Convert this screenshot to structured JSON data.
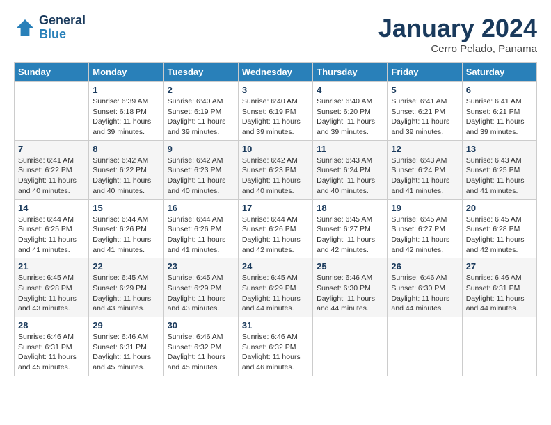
{
  "header": {
    "logo_line1": "General",
    "logo_line2": "Blue",
    "month": "January 2024",
    "location": "Cerro Pelado, Panama"
  },
  "days_of_week": [
    "Sunday",
    "Monday",
    "Tuesday",
    "Wednesday",
    "Thursday",
    "Friday",
    "Saturday"
  ],
  "weeks": [
    [
      {
        "day": "",
        "text": ""
      },
      {
        "day": "1",
        "text": "Sunrise: 6:39 AM\nSunset: 6:18 PM\nDaylight: 11 hours\nand 39 minutes."
      },
      {
        "day": "2",
        "text": "Sunrise: 6:40 AM\nSunset: 6:19 PM\nDaylight: 11 hours\nand 39 minutes."
      },
      {
        "day": "3",
        "text": "Sunrise: 6:40 AM\nSunset: 6:19 PM\nDaylight: 11 hours\nand 39 minutes."
      },
      {
        "day": "4",
        "text": "Sunrise: 6:40 AM\nSunset: 6:20 PM\nDaylight: 11 hours\nand 39 minutes."
      },
      {
        "day": "5",
        "text": "Sunrise: 6:41 AM\nSunset: 6:21 PM\nDaylight: 11 hours\nand 39 minutes."
      },
      {
        "day": "6",
        "text": "Sunrise: 6:41 AM\nSunset: 6:21 PM\nDaylight: 11 hours\nand 39 minutes."
      }
    ],
    [
      {
        "day": "7",
        "text": "Sunrise: 6:41 AM\nSunset: 6:22 PM\nDaylight: 11 hours\nand 40 minutes."
      },
      {
        "day": "8",
        "text": "Sunrise: 6:42 AM\nSunset: 6:22 PM\nDaylight: 11 hours\nand 40 minutes."
      },
      {
        "day": "9",
        "text": "Sunrise: 6:42 AM\nSunset: 6:23 PM\nDaylight: 11 hours\nand 40 minutes."
      },
      {
        "day": "10",
        "text": "Sunrise: 6:42 AM\nSunset: 6:23 PM\nDaylight: 11 hours\nand 40 minutes."
      },
      {
        "day": "11",
        "text": "Sunrise: 6:43 AM\nSunset: 6:24 PM\nDaylight: 11 hours\nand 40 minutes."
      },
      {
        "day": "12",
        "text": "Sunrise: 6:43 AM\nSunset: 6:24 PM\nDaylight: 11 hours\nand 41 minutes."
      },
      {
        "day": "13",
        "text": "Sunrise: 6:43 AM\nSunset: 6:25 PM\nDaylight: 11 hours\nand 41 minutes."
      }
    ],
    [
      {
        "day": "14",
        "text": "Sunrise: 6:44 AM\nSunset: 6:25 PM\nDaylight: 11 hours\nand 41 minutes."
      },
      {
        "day": "15",
        "text": "Sunrise: 6:44 AM\nSunset: 6:26 PM\nDaylight: 11 hours\nand 41 minutes."
      },
      {
        "day": "16",
        "text": "Sunrise: 6:44 AM\nSunset: 6:26 PM\nDaylight: 11 hours\nand 41 minutes."
      },
      {
        "day": "17",
        "text": "Sunrise: 6:44 AM\nSunset: 6:26 PM\nDaylight: 11 hours\nand 42 minutes."
      },
      {
        "day": "18",
        "text": "Sunrise: 6:45 AM\nSunset: 6:27 PM\nDaylight: 11 hours\nand 42 minutes."
      },
      {
        "day": "19",
        "text": "Sunrise: 6:45 AM\nSunset: 6:27 PM\nDaylight: 11 hours\nand 42 minutes."
      },
      {
        "day": "20",
        "text": "Sunrise: 6:45 AM\nSunset: 6:28 PM\nDaylight: 11 hours\nand 42 minutes."
      }
    ],
    [
      {
        "day": "21",
        "text": "Sunrise: 6:45 AM\nSunset: 6:28 PM\nDaylight: 11 hours\nand 43 minutes."
      },
      {
        "day": "22",
        "text": "Sunrise: 6:45 AM\nSunset: 6:29 PM\nDaylight: 11 hours\nand 43 minutes."
      },
      {
        "day": "23",
        "text": "Sunrise: 6:45 AM\nSunset: 6:29 PM\nDaylight: 11 hours\nand 43 minutes."
      },
      {
        "day": "24",
        "text": "Sunrise: 6:45 AM\nSunset: 6:29 PM\nDaylight: 11 hours\nand 44 minutes."
      },
      {
        "day": "25",
        "text": "Sunrise: 6:46 AM\nSunset: 6:30 PM\nDaylight: 11 hours\nand 44 minutes."
      },
      {
        "day": "26",
        "text": "Sunrise: 6:46 AM\nSunset: 6:30 PM\nDaylight: 11 hours\nand 44 minutes."
      },
      {
        "day": "27",
        "text": "Sunrise: 6:46 AM\nSunset: 6:31 PM\nDaylight: 11 hours\nand 44 minutes."
      }
    ],
    [
      {
        "day": "28",
        "text": "Sunrise: 6:46 AM\nSunset: 6:31 PM\nDaylight: 11 hours\nand 45 minutes."
      },
      {
        "day": "29",
        "text": "Sunrise: 6:46 AM\nSunset: 6:31 PM\nDaylight: 11 hours\nand 45 minutes."
      },
      {
        "day": "30",
        "text": "Sunrise: 6:46 AM\nSunset: 6:32 PM\nDaylight: 11 hours\nand 45 minutes."
      },
      {
        "day": "31",
        "text": "Sunrise: 6:46 AM\nSunset: 6:32 PM\nDaylight: 11 hours\nand 46 minutes."
      },
      {
        "day": "",
        "text": ""
      },
      {
        "day": "",
        "text": ""
      },
      {
        "day": "",
        "text": ""
      }
    ]
  ]
}
